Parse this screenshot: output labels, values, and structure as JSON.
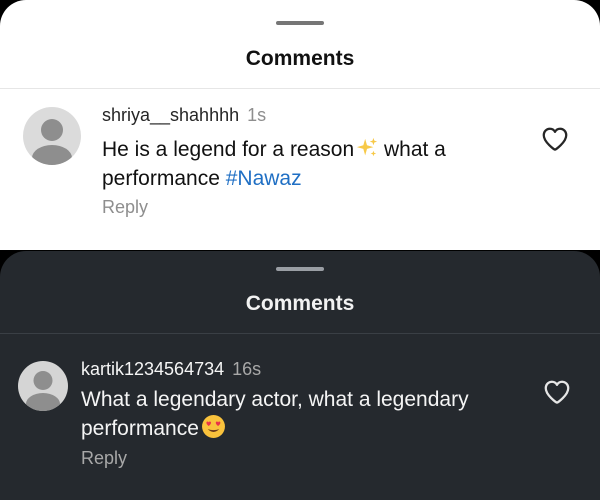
{
  "top_sheet": {
    "title": "Comments",
    "comment": {
      "username": "shriya__shahhhh",
      "time": "1s",
      "text_line1": "He is a legend for a reason",
      "text_after_sparkle": " what a",
      "text_line2": "performance ",
      "hashtag": "#Nawaz",
      "reply_label": "Reply",
      "icons": [
        "avatar-placeholder-icon",
        "sparkles-icon",
        "heart-icon"
      ]
    }
  },
  "bottom_sheet": {
    "title": "Comments",
    "comment": {
      "username": "kartik1234564734",
      "time": "16s",
      "text_line1": "What a legendary actor, what a legendary",
      "text_line2": "performance",
      "reply_label": "Reply",
      "icons": [
        "avatar-placeholder-icon",
        "heart-eyes-emoji-icon",
        "heart-icon"
      ]
    }
  },
  "colors": {
    "light_bg": "#ffffff",
    "dark_bg": "#25292e",
    "hashtag": "#1f6fc4",
    "muted": "#8e8e8e"
  }
}
